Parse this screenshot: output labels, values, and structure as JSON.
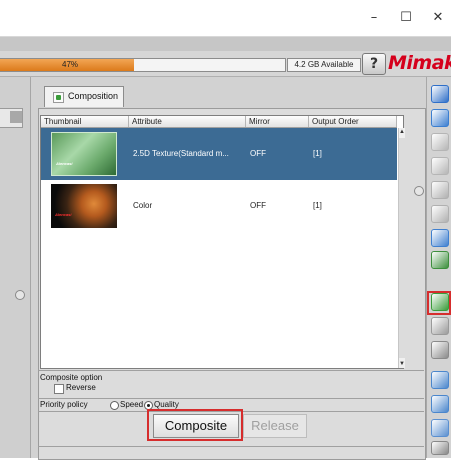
{
  "window": {
    "minimize_glyph": "–",
    "maximize_glyph": "☐",
    "close_glyph": "✕"
  },
  "status": {
    "progress": 0.47,
    "progress_text": "47%",
    "storage_text": "4.2 GB Available",
    "help_glyph": "?",
    "logo_text": "Mimaki"
  },
  "tab": {
    "label": "Composition"
  },
  "grid": {
    "columns": [
      "Thumbnail",
      "Attribute",
      "Mirror",
      "Output Order"
    ],
    "rows": [
      {
        "thumb_text": "Alencasi",
        "attribute": "2.5D Texture(Standard m...",
        "mirror": "OFF",
        "output_order": "[1]",
        "selected": true
      },
      {
        "thumb_text": "Alencasi",
        "attribute": "Color",
        "mirror": "OFF",
        "output_order": "[1]",
        "selected": false
      }
    ],
    "scroll_up_glyph": "▲",
    "scroll_down_glyph": "▼"
  },
  "options": {
    "composite_option_label": "Composite option",
    "reverse_label": "Reverse",
    "reverse_checked": false,
    "priority_label": "Priority policy",
    "speed_label": "Speed",
    "quality_label": "Quality",
    "selected_priority": "Quality"
  },
  "buttons": {
    "composite": "Composite",
    "release": "Release"
  },
  "toolbar": {
    "items": [
      {
        "icon": "info-icon",
        "color": "#2f6fc8"
      },
      {
        "icon": "layer-settings-icon",
        "color": "#3b7ed0"
      },
      {
        "icon": "disabled-tool-1-icon",
        "color": "#b5b5b5"
      },
      {
        "icon": "disabled-tool-2-icon",
        "color": "#b5b5b5"
      },
      {
        "icon": "disabled-tool-3-icon",
        "color": "#b0b0b0"
      },
      {
        "icon": "disabled-tool-4-icon",
        "color": "#b0b0b0"
      },
      {
        "icon": "monitor-icon",
        "color": "#3f7fcf"
      },
      {
        "icon": "special-color-icon",
        "color": "#3d8f3d"
      },
      {
        "icon": "composition-icon",
        "color": "#3a9c3a"
      },
      {
        "icon": "move-icon",
        "color": "#9a9a9a"
      },
      {
        "icon": "crosshair-icon",
        "color": "#8a8a8a"
      },
      {
        "icon": "copy-icon",
        "color": "#4a86cc"
      },
      {
        "icon": "split-icon",
        "color": "#4a86cc"
      },
      {
        "icon": "trash-icon",
        "color": "#5a8fd0"
      },
      {
        "icon": "help-icon",
        "color": "#888888"
      }
    ]
  }
}
